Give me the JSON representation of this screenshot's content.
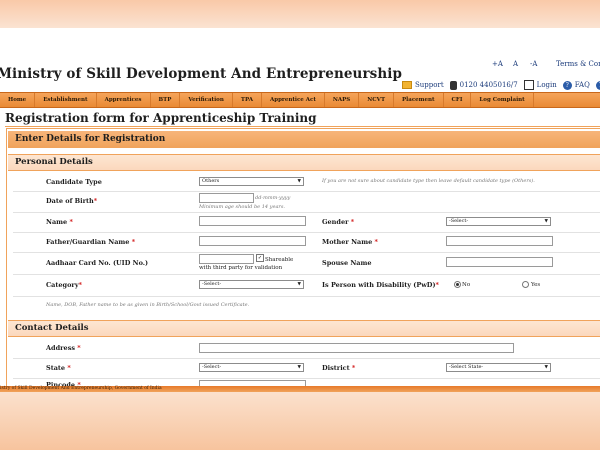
{
  "header": {
    "ministry_title": "Ministry of Skill Development And Entrepreneurship",
    "font_sizes": [
      "+A",
      "A",
      "-A"
    ],
    "terms_link": "Terms & Condi",
    "support": "Support",
    "phone": "0120 4405016/7",
    "login": "Login",
    "faq": "FAQ",
    "help": "H"
  },
  "nav": [
    "Home",
    "Establishment",
    "Apprentices",
    "BTP",
    "Verification",
    "TPA",
    "Apprentice Act",
    "NAPS",
    "NCVT",
    "Placement",
    "CFI",
    "Log Complaint"
  ],
  "page_title": "Registration form for Apprenticeship Training",
  "panel_title": "Enter Details for Registration",
  "personal": {
    "section_title": "Personal Details",
    "candidate_type_label": "Candidate Type",
    "candidate_type_value": "Others",
    "candidate_type_hint": "If you are not sure about candidate type then leave default candidate type (Others).",
    "dob_label": "Date of Birth",
    "dob_placeholder": "dd-mmm-yyyy",
    "dob_hint": "Minimum age should be 14 years.",
    "name_label": "Name",
    "gender_label": "Gender",
    "gender_value": "-Select-",
    "father_label": "Father/Guardian Name",
    "mother_label": "Mother Name",
    "aadhaar_label": "Aadhaar Card No. (UID No.)",
    "shareable_label": "Shareable with third party for validation",
    "spouse_label": "Spouse Name",
    "category_label": "Category",
    "category_value": "-Select-",
    "pwd_label": "Is Person with Disability (PwD)",
    "pwd_no": "No",
    "pwd_yes": "Yes",
    "note": "Name, DOB, Father name to be as given in Birth/School/Govt issued Certificate."
  },
  "contact": {
    "section_title": "Contact Details",
    "address_label": "Address",
    "state_label": "State",
    "state_value": "-Select-",
    "district_label": "District",
    "district_value": "-Select State-",
    "pincode_label": "Pincode"
  },
  "footer": {
    "text": "istry of Skill Development And Entrepreneurship, Government of India"
  }
}
